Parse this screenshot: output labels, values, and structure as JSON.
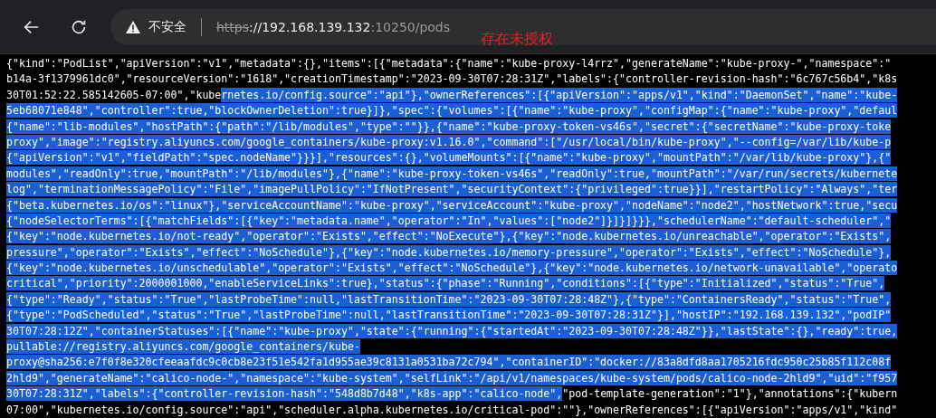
{
  "toolbar": {
    "security_label": "不安全",
    "url": {
      "scheme": "https",
      "host": "://192.168.139.132",
      "path": ":10250/pods"
    }
  },
  "annotation": "存在未授权",
  "lines": [
    {
      "segments": [
        {
          "text": "{\"kind\":\"PodList\",\"apiVersion\":\"v1\",\"metadata\":{},\"items\":[{\"metadata\":{\"name\":\"kube-proxy-l4rrz\",\"generateName\":\"kube-proxy-\",\"namespace\":\"",
          "selected": false
        }
      ]
    },
    {
      "segments": [
        {
          "text": "b14a-3f1379961dc0\",\"resourceVersion\":\"1618\",\"creationTimestamp\":\"2023-09-30T07:28:31Z\",\"labels\":{\"controller-revision-hash\":\"6c767c56b4\",\"k8s",
          "selected": false
        }
      ]
    },
    {
      "segments": [
        {
          "text": "30T01:52:22.585142605-07:00\",\"kube",
          "selected": false
        },
        {
          "text": "rnetes.io/config.source\":\"api\"},\"ownerReferences\":[{\"apiVersion\":\"apps/v1\",\"kind\":\"DaemonSet\",\"name\":\"kube-",
          "selected": true
        }
      ]
    },
    {
      "segments": [
        {
          "text": "5eb68071e848\",\"controller\":true,\"blockOwnerDeletion\":true}]},\"spec\":{\"volumes\":[{\"name\":\"kube-proxy\",\"configMap\":{\"name\":\"kube-proxy\",\"defaul",
          "selected": true
        }
      ]
    },
    {
      "segments": [
        {
          "text": "{\"name\":\"lib-modules\",\"hostPath\":{\"path\":\"/lib/modules\",\"type\":\"\"}},{\"name\":\"kube-proxy-token-vs46s\",\"secret\":{\"secretName\":\"kube-proxy-toke",
          "selected": true
        }
      ]
    },
    {
      "segments": [
        {
          "text": "proxy\",\"image\":\"registry.aliyuncs.com/google_containers/kube-proxy:v1.16.0\",\"command\":[\"/usr/local/bin/kube-proxy\",\"--config=/var/lib/kube-p",
          "selected": true
        }
      ]
    },
    {
      "segments": [
        {
          "text": "{\"apiVersion\":\"v1\",\"fieldPath\":\"spec.nodeName\"}}}],\"resources\":{},\"volumeMounts\":[{\"name\":\"kube-proxy\",\"mountPath\":\"/var/lib/kube-proxy\"},{\"",
          "selected": true
        }
      ]
    },
    {
      "segments": [
        {
          "text": "modules\",\"readOnly\":true,\"mountPath\":\"/lib/modules\"},{\"name\":\"kube-proxy-token-vs46s\",\"readOnly\":true,\"mountPath\":\"/var/run/secrets/kubernete",
          "selected": true
        }
      ]
    },
    {
      "segments": [
        {
          "text": "log\",\"terminationMessagePolicy\":\"File\",\"imagePullPolicy\":\"IfNotPresent\",\"securityContext\":{\"privileged\":true}}],\"restartPolicy\":\"Always\",\"ter",
          "selected": true
        }
      ]
    },
    {
      "segments": [
        {
          "text": "{\"beta.kubernetes.io/os\":\"linux\"},\"serviceAccountName\":\"kube-proxy\",\"serviceAccount\":\"kube-proxy\",\"nodeName\":\"node2\",\"hostNetwork\":true,\"secu",
          "selected": true
        }
      ]
    },
    {
      "segments": [
        {
          "text": "{\"nodeSelectorTerms\":[{\"matchFields\":[{\"key\":\"metadata.name\",\"operator\":\"In\",\"values\":[\"node2\"]}]}]}}},\"schedulerName\":\"default-scheduler\",\"",
          "selected": true
        }
      ]
    },
    {
      "segments": [
        {
          "text": "{\"key\":\"node.kubernetes.io/not-ready\",\"operator\":\"Exists\",\"effect\":\"NoExecute\"},{\"key\":\"node.kubernetes.io/unreachable\",\"operator\":\"Exists\",",
          "selected": true
        }
      ]
    },
    {
      "segments": [
        {
          "text": "pressure\",\"operator\":\"Exists\",\"effect\":\"NoSchedule\"},{\"key\":\"node.kubernetes.io/memory-pressure\",\"operator\":\"Exists\",\"effect\":\"NoSchedule\"},",
          "selected": true
        }
      ]
    },
    {
      "segments": [
        {
          "text": "{\"key\":\"node.kubernetes.io/unschedulable\",\"operator\":\"Exists\",\"effect\":\"NoSchedule\"},{\"key\":\"node.kubernetes.io/network-unavailable\",\"operato",
          "selected": true
        }
      ]
    },
    {
      "segments": [
        {
          "text": "critical\",\"priority\":2000001000,\"enableServiceLinks\":true},\"status\":{\"phase\":\"Running\",\"conditions\":[{\"type\":\"Initialized\",\"status\":\"True\",",
          "selected": true
        }
      ]
    },
    {
      "segments": [
        {
          "text": "{\"type\":\"Ready\",\"status\":\"True\",\"lastProbeTime\":null,\"lastTransitionTime\":\"2023-09-30T07:28:48Z\"},{\"type\":\"ContainersReady\",\"status\":\"True\",",
          "selected": true
        }
      ]
    },
    {
      "segments": [
        {
          "text": "{\"type\":\"PodScheduled\",\"status\":\"True\",\"lastProbeTime\":null,\"lastTransitionTime\":\"2023-09-30T07:28:31Z\"}],\"hostIP\":\"192.168.139.132\",\"podIP\"",
          "selected": true
        }
      ]
    },
    {
      "segments": [
        {
          "text": "30T07:28:12Z\",\"containerStatuses\":[{\"name\":\"kube-proxy\",\"state\":{\"running\":{\"startedAt\":\"2023-09-30T07:28:48Z\"}},\"lastState\":{},\"ready\":true,",
          "selected": true
        }
      ]
    },
    {
      "segments": [
        {
          "text": "pullable://registry.aliyuncs.com/google_containers/kube-",
          "selected": true
        }
      ]
    },
    {
      "segments": [
        {
          "text": "proxy@sha256:e7f0f8e320cfeeaafdc9c0cb8e23f51e542fa1d955ae39c8131a0531ba72c794\",\"containerID\":\"docker://83a8dfd8aa1705216fdc950c25b85f112c08f",
          "selected": true
        }
      ]
    },
    {
      "segments": [
        {
          "text": "2hld9\",\"generateName\":\"calico-node-\",\"namespace\":\"kube-system\",\"selfLink\":\"/api/v1/namespaces/kube-system/pods/calico-node-2hld9\",\"uid\":\"f957",
          "selected": true
        }
      ]
    },
    {
      "segments": [
        {
          "text": "30T07:28:31Z\",\"labels\":{\"controller-revision-hash\":\"548d8b7d48\",\"k8s-app\":\"calico-node\",",
          "selected": true
        },
        {
          "text": "\"pod-template-generation\":\"1\"},\"annotations\":{\"kubern",
          "selected": false
        }
      ]
    },
    {
      "segments": [
        {
          "text": "07:00\",\"kubernetes.io/config.source\":\"api\",\"scheduler.alpha.kubernetes.io/critical-pod\":\"\"},\"ownerReferences\":[{\"apiVersion\":\"apps/v1\",\"kind\"",
          "selected": false
        }
      ]
    }
  ]
}
